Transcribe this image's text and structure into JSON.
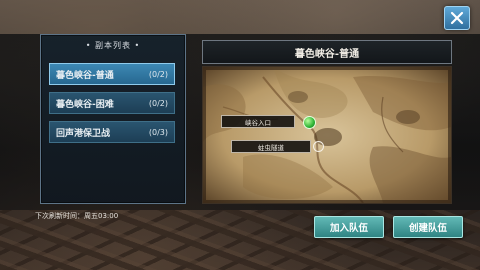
{
  "list": {
    "title": "• 副本列表 •",
    "items": [
      {
        "label": "暮色峡谷-普通",
        "count": "(0/2)"
      },
      {
        "label": "暮色峡谷-困难",
        "count": "(0/2)"
      },
      {
        "label": "回声港保卫战",
        "count": "(0/3)"
      }
    ]
  },
  "refresh_text": "下次刷新时间：周五03:00",
  "map": {
    "title": "暮色峡谷-普通",
    "labels": {
      "entrance": "峡谷入口",
      "tunnel": "蛀虫隧道"
    }
  },
  "buttons": {
    "join_team": "加入队伍",
    "create_team": "创建队伍"
  },
  "colors": {
    "accent": "#3d88b4",
    "button": "#4aa3a0",
    "marker": "#2fb436"
  }
}
